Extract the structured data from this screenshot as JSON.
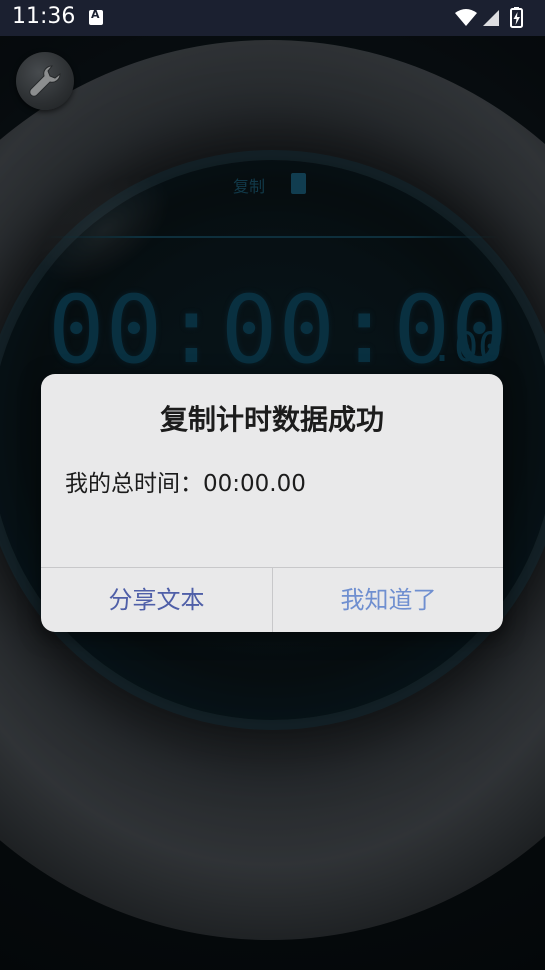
{
  "status_bar": {
    "time": "11:36",
    "icons": [
      "notification-a-icon",
      "wifi-icon",
      "signal-icon",
      "battery-charging-icon"
    ]
  },
  "app": {
    "settings_icon": "wrench-icon",
    "copy_label": "复制",
    "copy_icon": "clipboard-icon",
    "timer_main": "00:00:00",
    "timer_fraction": ".00",
    "display_color": "#0f4a63"
  },
  "dialog": {
    "title": "复制计时数据成功",
    "message": "我的总时间：00:00.00",
    "share_button": "分享文本",
    "ok_button": "我知道了",
    "share_color": "#4f5fa8",
    "ok_color": "#6f8fd0"
  }
}
